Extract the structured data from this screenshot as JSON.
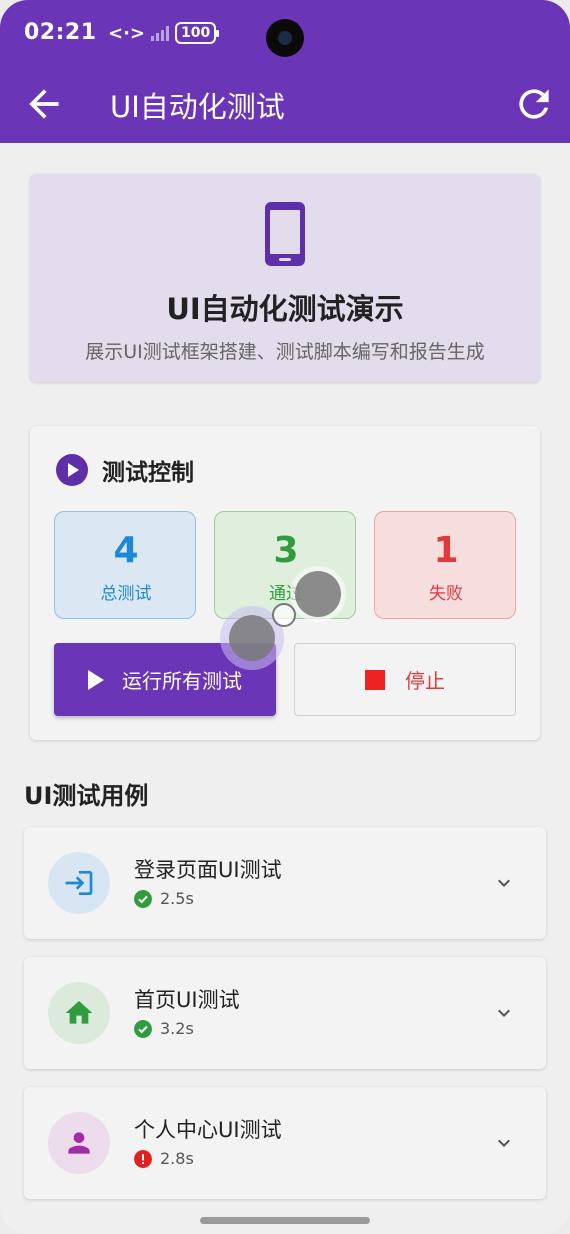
{
  "status_bar": {
    "time": "02:21",
    "battery": "100"
  },
  "app_bar": {
    "title": "UI自动化测试"
  },
  "hero": {
    "title": "UI自动化测试演示",
    "subtitle": "展示UI测试框架搭建、测试脚本编写和报告生成"
  },
  "control": {
    "title": "测试控制",
    "stats": [
      {
        "value": "4",
        "label": "总测试"
      },
      {
        "value": "3",
        "label": "通过"
      },
      {
        "value": "1",
        "label": "失败"
      }
    ],
    "run_label": "运行所有测试",
    "stop_label": "停止"
  },
  "cases": {
    "section_title": "UI测试用例",
    "items": [
      {
        "name": "登录页面UI测试",
        "time": "2.5s",
        "status": "pass",
        "icon": "login-icon"
      },
      {
        "name": "首页UI测试",
        "time": "3.2s",
        "status": "pass",
        "icon": "home-icon"
      },
      {
        "name": "个人中心UI测试",
        "time": "2.8s",
        "status": "fail",
        "icon": "person-icon"
      }
    ]
  },
  "colors": {
    "primary": "#6a35b6",
    "pass": "#2e9c3f",
    "fail": "#e03b3b",
    "total": "#1e88d6"
  }
}
